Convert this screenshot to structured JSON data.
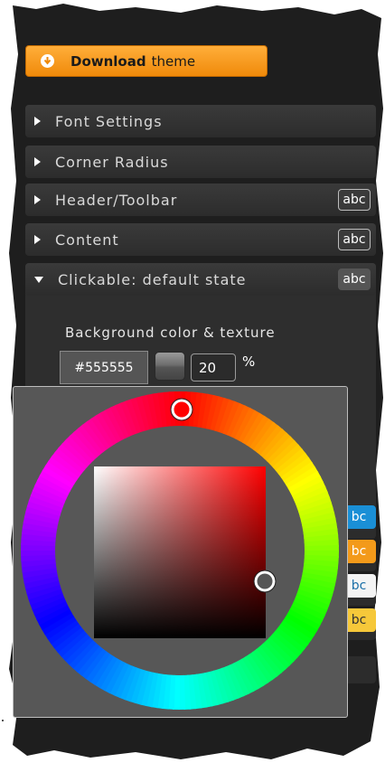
{
  "download": {
    "bold": "Download",
    "rest": "theme"
  },
  "sections": [
    {
      "label": "Font Settings",
      "abc": ""
    },
    {
      "label": "Corner Radius",
      "abc": ""
    },
    {
      "label": "Header/Toolbar",
      "abc": "abc"
    },
    {
      "label": "Content",
      "abc": "abc"
    },
    {
      "label": "Clickable: default state",
      "abc": "abc"
    }
  ],
  "background": {
    "label": "Background color & texture",
    "hex_value": "#555555",
    "texture_percent": "20",
    "percent_sign": "%"
  },
  "side_swatches": [
    {
      "label": "bc",
      "color": "#1a8fd6",
      "text_color": "#ffffff"
    },
    {
      "label": "bc",
      "color": "#f39a1a",
      "text_color": "#ffffff"
    },
    {
      "label": "bc",
      "color": "#f4f4f4",
      "text_color": "#1a6fa8"
    },
    {
      "label": "bc",
      "color": "#f6c83a",
      "text_color": "#333333"
    }
  ],
  "color_picker": {
    "selected_hue_color": "#ff0000",
    "selected_color": "#555555"
  },
  "colors": {
    "panel": "#1e1e1e",
    "accent_orange": "#f39a1a"
  }
}
